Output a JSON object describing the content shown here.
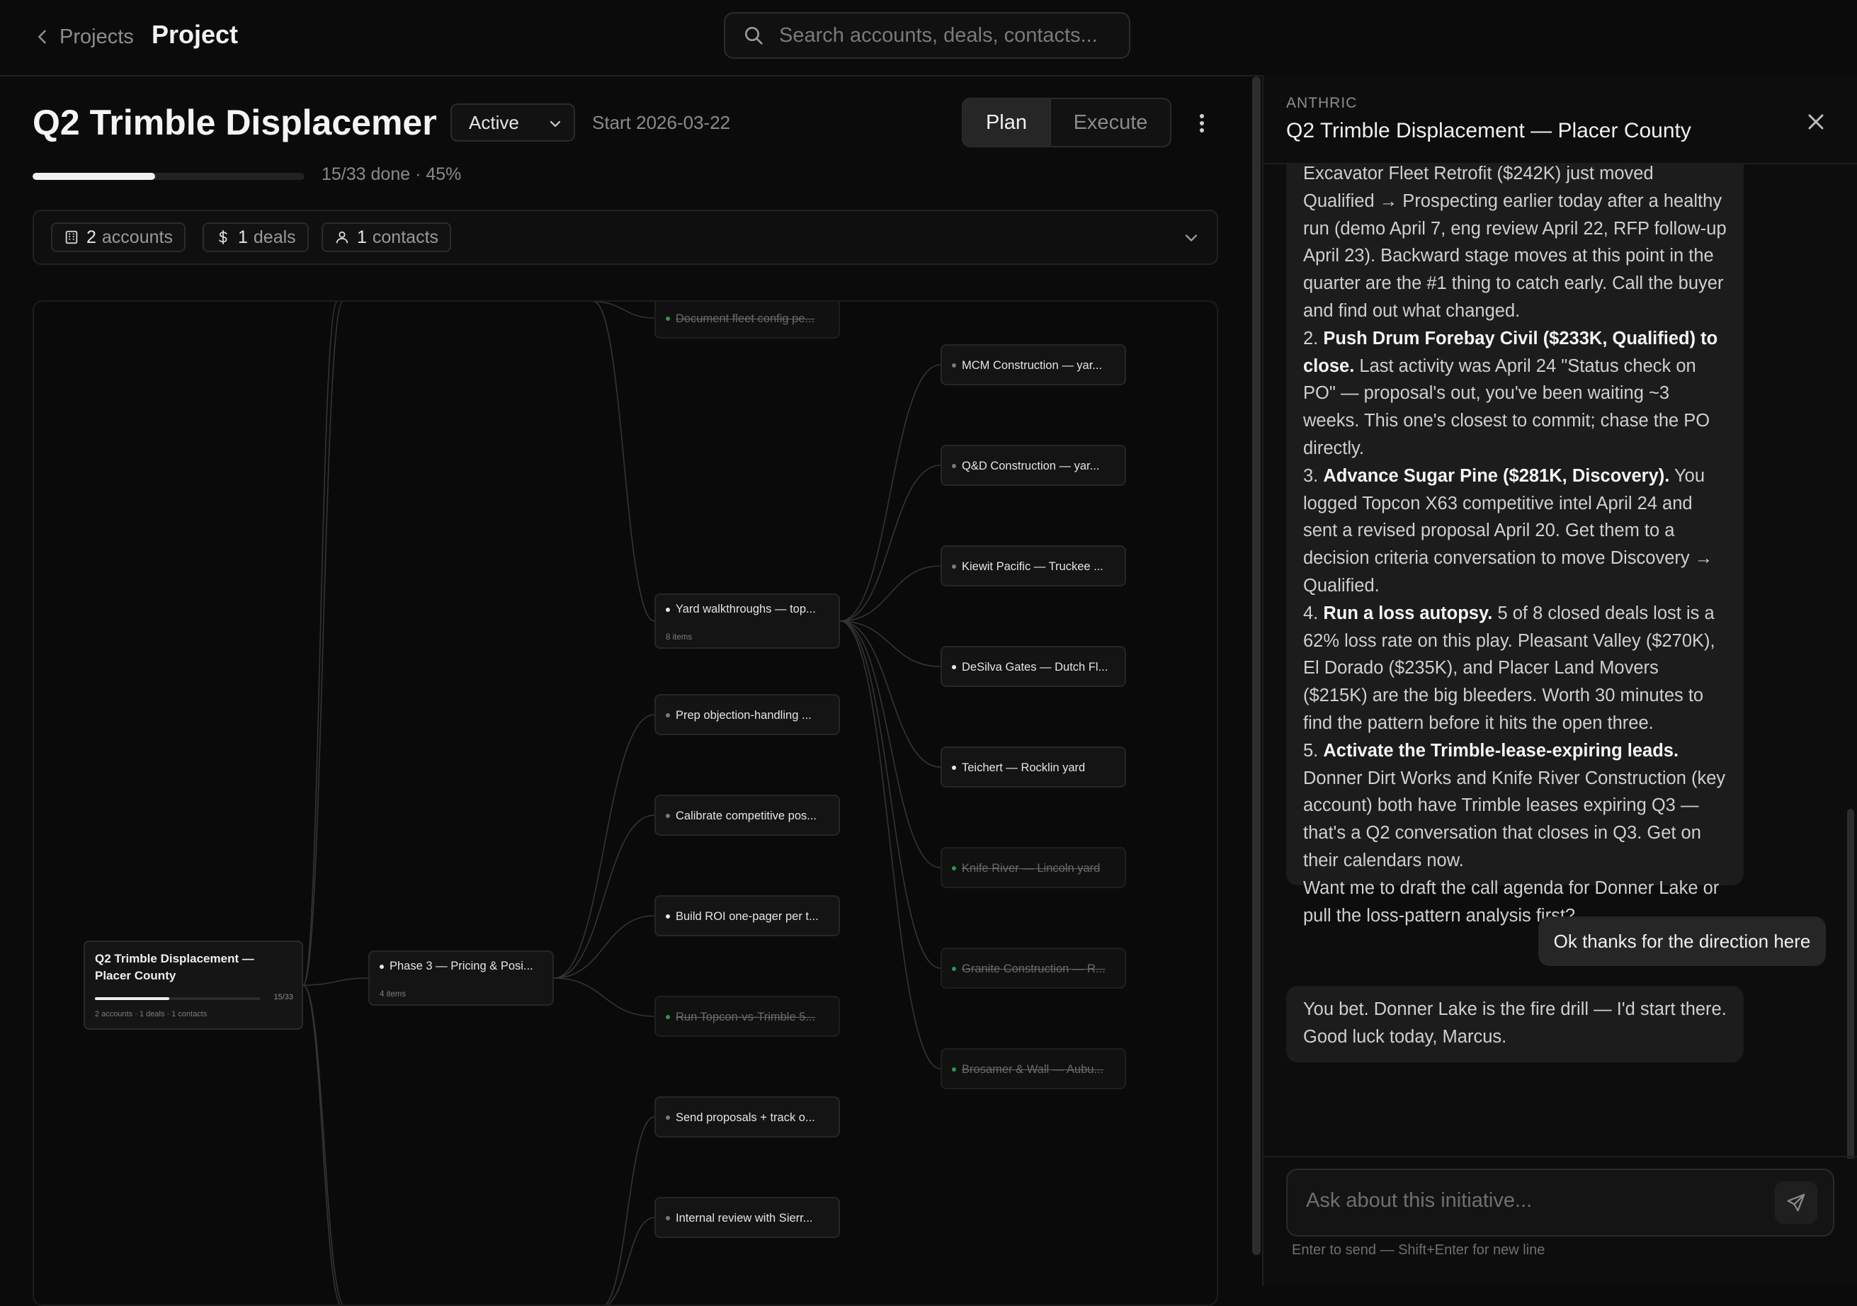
{
  "header": {
    "back_label": "Projects",
    "page_title": "Project",
    "search_placeholder": "Search accounts, deals, contacts..."
  },
  "project": {
    "name": "Q2 Trimble Displacemen",
    "status": "Active",
    "start_date": "Start 2026-03-22",
    "modes": {
      "plan": "Plan",
      "execute": "Execute",
      "active": "plan"
    },
    "progress": {
      "done": 15,
      "total": 33,
      "percent": 45,
      "text": "15/33 done · 45%"
    },
    "chips": [
      {
        "count": "2",
        "label": "accounts",
        "icon": "building-icon"
      },
      {
        "count": "1",
        "label": "deals",
        "icon": "dollar-icon"
      },
      {
        "count": "1",
        "label": "contacts",
        "icon": "person-icon"
      }
    ]
  },
  "tree": {
    "root": {
      "title": "Q2 Trimble Displacement — Placer County",
      "count": "15/33",
      "meta": "2 accounts · 1 deals · 1 contacts",
      "progress": 0.45
    },
    "phase": {
      "label": "Phase 3 — Pricing & Posi...",
      "sub": "4 items"
    },
    "items": [
      {
        "label": "Document fleet config pe...",
        "done": true
      },
      {
        "label": "Yard walkthroughs — top...",
        "sub": "8 items"
      },
      {
        "label": "Prep objection-handling ...",
        "muted": true
      },
      {
        "label": "Calibrate competitive pos...",
        "muted": true
      },
      {
        "label": "Build ROI one-pager per t..."
      },
      {
        "label": "Run Topcon-vs-Trimble 5...",
        "done": true
      },
      {
        "label": "Send proposals + track o...",
        "muted": true
      },
      {
        "label": "Internal review with Sierr...",
        "muted": true
      }
    ],
    "yards": [
      {
        "label": "MCM Construction — yar...",
        "muted": true
      },
      {
        "label": "Q&D Construction — yar...",
        "muted": true
      },
      {
        "label": "Kiewit Pacific — Truckee ...",
        "muted": true
      },
      {
        "label": "DeSilva Gates — Dutch Fl..."
      },
      {
        "label": "Teichert — Rocklin yard"
      },
      {
        "label": "Knife River — Lincoln yard",
        "done": true
      },
      {
        "label": "Granite Construction — R...",
        "done": true
      },
      {
        "label": "Brosamer & Wall — Aubu...",
        "done": true
      }
    ]
  },
  "panel": {
    "kicker": "ANTHRIC",
    "title": "Q2 Trimble Displacement — Placer County",
    "messages": {
      "assistant_intro": "Excavator Fleet Retrofit ($242K) just moved Qualified → Prospecting earlier today after a healthy run (demo April 7, eng review April 22, RFP follow-up April 23). Backward stage moves at this point in the quarter are the #1 thing to catch early. Call the buyer and find out what changed.",
      "points": [
        {
          "num": "2.",
          "bold": "Push Drum Forebay Civil ($233K, Qualified) to close.",
          "text": " Last activity was April 24 \"Status check on PO\" — proposal's out, you've been waiting ~3 weeks. This one's closest to commit; chase the PO directly."
        },
        {
          "num": "3.",
          "bold": "Advance Sugar Pine ($281K, Discovery).",
          "text": " You logged Topcon X63 competitive intel April 24 and sent a revised proposal April 20. Get them to a decision criteria conversation to move Discovery → Qualified."
        },
        {
          "num": "4.",
          "bold": "Run a loss autopsy.",
          "text": " 5 of 8 closed deals lost is a 62% loss rate on this play. Pleasant Valley ($270K), El Dorado ($235K), and Placer Land Movers ($215K) are the big bleeders. Worth 30 minutes to find the pattern before it hits the open three."
        },
        {
          "num": "5.",
          "bold": "Activate the Trimble-lease-expiring leads.",
          "text": " Donner Dirt Works and Knife River Construction (key account) both have Trimble leases expiring Q3 — that's a Q2 conversation that closes in Q3. Get on their calendars now."
        }
      ],
      "assistant_outro": "Want me to draft the call agenda for Donner Lake or pull the loss-pattern analysis first?",
      "user": "Ok thanks for the direction here",
      "reply": "You bet. Donner Lake is the fire drill — I'd start there. Good luck today, Marcus."
    },
    "composer_placeholder": "Ask about this initiative...",
    "composer_hint": "Enter to send — Shift+Enter for new line"
  }
}
